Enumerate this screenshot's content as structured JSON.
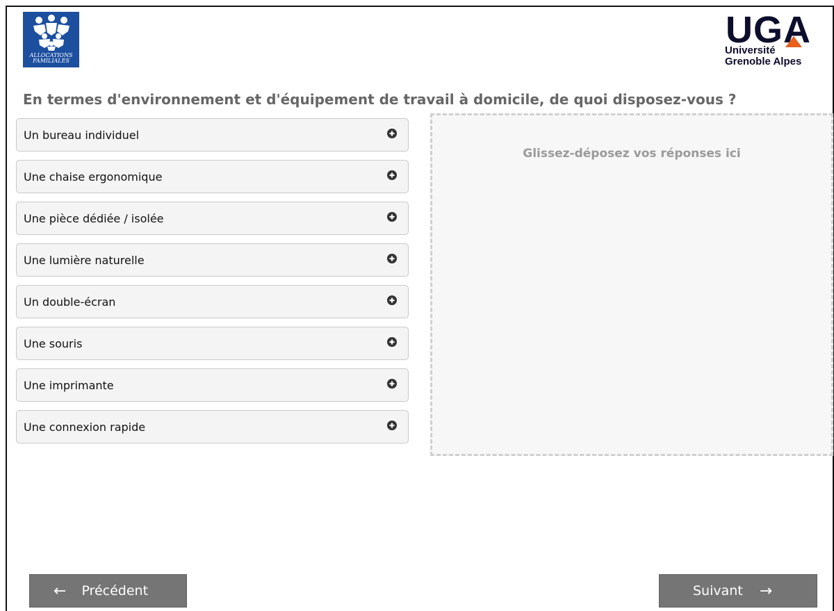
{
  "logos": {
    "caf_line1": "ALLOCATIONS",
    "caf_line2": "FAMILIALES",
    "uga_letters": "UGA",
    "uga_line1": "Université",
    "uga_line2": "Grenoble Alpes"
  },
  "question": "En termes d'environnement et d'équipement de travail à domicile, de quoi disposez-vous ?",
  "options": [
    {
      "label": "Un bureau individuel",
      "icon": "plus-circle-icon"
    },
    {
      "label": "Une chaise ergonomique",
      "icon": "plus-circle-icon"
    },
    {
      "label": "Une pièce dédiée / isolée",
      "icon": "plus-circle-icon"
    },
    {
      "label": "Une lumière naturelle",
      "icon": "plus-circle-icon"
    },
    {
      "label": "Un double-écran",
      "icon": "plus-circle-icon"
    },
    {
      "label": "Une souris",
      "icon": "plus-circle-icon"
    },
    {
      "label": "Une imprimante",
      "icon": "plus-circle-icon"
    },
    {
      "label": "Une connexion rapide",
      "icon": "plus-circle-icon"
    }
  ],
  "dropzone": {
    "label": "Glissez-déposez vos réponses ici"
  },
  "nav": {
    "prev_label": "Précédent",
    "prev_icon": "arrow-left-icon",
    "next_label": "Suivant",
    "next_icon": "arrow-right-icon"
  },
  "colors": {
    "caf_blue": "#1d4f9f",
    "uga_navy": "#0d0d2c",
    "uga_orange": "#e8601c",
    "button_gray": "#757575"
  }
}
